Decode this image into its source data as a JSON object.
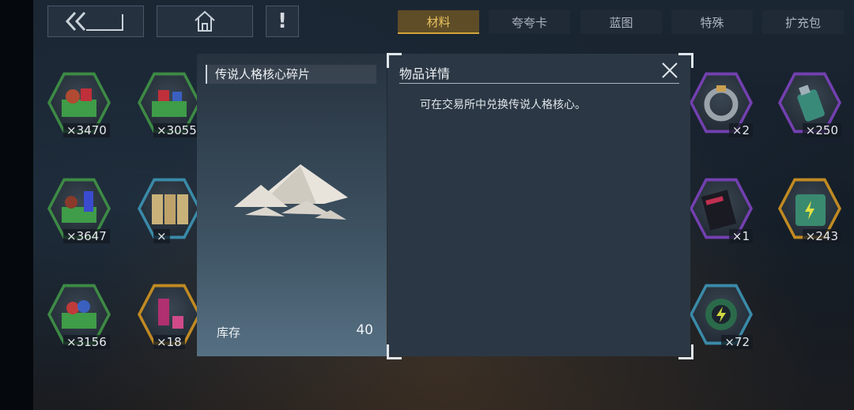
{
  "top_bar": {
    "back_icon": "double-chevron-left-icon",
    "home_icon": "home-icon",
    "alert_label": "!"
  },
  "tabs": [
    {
      "label": "材料",
      "active": true
    },
    {
      "label": "夸夸卡",
      "active": false
    },
    {
      "label": "蓝图",
      "active": false
    },
    {
      "label": "特殊",
      "active": false
    },
    {
      "label": "扩充包",
      "active": false
    }
  ],
  "inventory": {
    "left_col1": [
      {
        "count": "×3470",
        "rarity": "green",
        "icon": "basket-icon"
      },
      {
        "count": "×3647",
        "rarity": "green",
        "icon": "basket-icon"
      },
      {
        "count": "×3156",
        "rarity": "green",
        "icon": "basket-icon"
      }
    ],
    "left_col2": [
      {
        "count": "×3055",
        "rarity": "green",
        "icon": "basket-icon"
      },
      {
        "count": "×",
        "rarity": "blue",
        "icon": "jars-icon"
      },
      {
        "count": "×18",
        "rarity": "gold",
        "icon": "crystal-icon"
      }
    ],
    "right_col1": [
      {
        "count": "×2",
        "rarity": "purple",
        "icon": "ring-icon"
      },
      {
        "count": "×1",
        "rarity": "purple",
        "icon": "card-icon"
      },
      {
        "count": "×72",
        "rarity": "blue",
        "icon": "medal-icon"
      }
    ],
    "right_col2": [
      {
        "count": "×250",
        "rarity": "purple",
        "icon": "bottle-icon"
      },
      {
        "count": "×243",
        "rarity": "gold",
        "icon": "battery-icon"
      }
    ]
  },
  "item_modal": {
    "item_name": "传说人格核心碎片",
    "item_icon": "powder-pile-icon",
    "stock_label": "库存",
    "stock_value": "40",
    "detail_title": "物品详情",
    "description": "可在交易所中兑换传说人格核心。",
    "close_icon": "close-icon"
  },
  "colors": {
    "active_tab": "#d2a53a",
    "panel": "#2b3744"
  }
}
